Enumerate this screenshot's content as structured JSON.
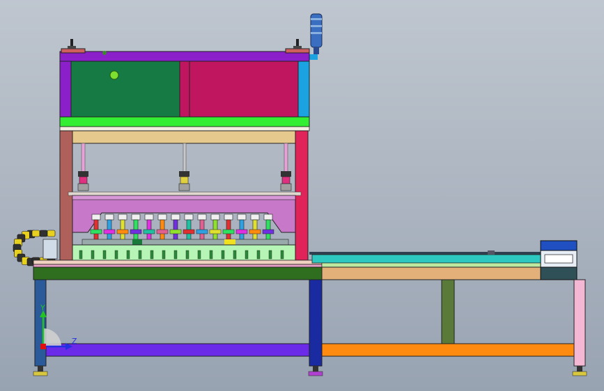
{
  "viewport": {
    "background_top": "#bfc6cf",
    "background_bottom": "#98a3b2"
  },
  "triad": {
    "y_label": "Y",
    "z_label": "Z",
    "y_color": "#22c322",
    "z_color": "#2230e0",
    "origin_color": "#e01010"
  },
  "colors": {
    "top_frame": "#8b1fc9",
    "green_panel": "#157a43",
    "crimson_panel": "#c0155f",
    "cyan_post": "#1aa3e0",
    "lime_beam": "#33ee33",
    "tan_beam": "#e6c98c",
    "left_column": "#b0605a",
    "right_column": "#e0245a",
    "press_plate": "#c878c8",
    "mold_base": "#b6f5b6",
    "bed_green": "#2f6e1f",
    "pink_strip": "#e8a0c8",
    "conveyor_top": "#2dc9c0",
    "conveyor_mid": "#bfe8a0",
    "conveyor_beam": "#e3b07a",
    "left_leg": "#2a5a9a",
    "mid_leg": "#1a2aa0",
    "right_leg": "#f4b8d4",
    "purple_rail": "#6a2ae8",
    "orange_rail": "#ff8a10",
    "olive_leg": "#5a7a3a",
    "end_box": "#1f4fc0",
    "tower_light": "#3a6ec0"
  }
}
